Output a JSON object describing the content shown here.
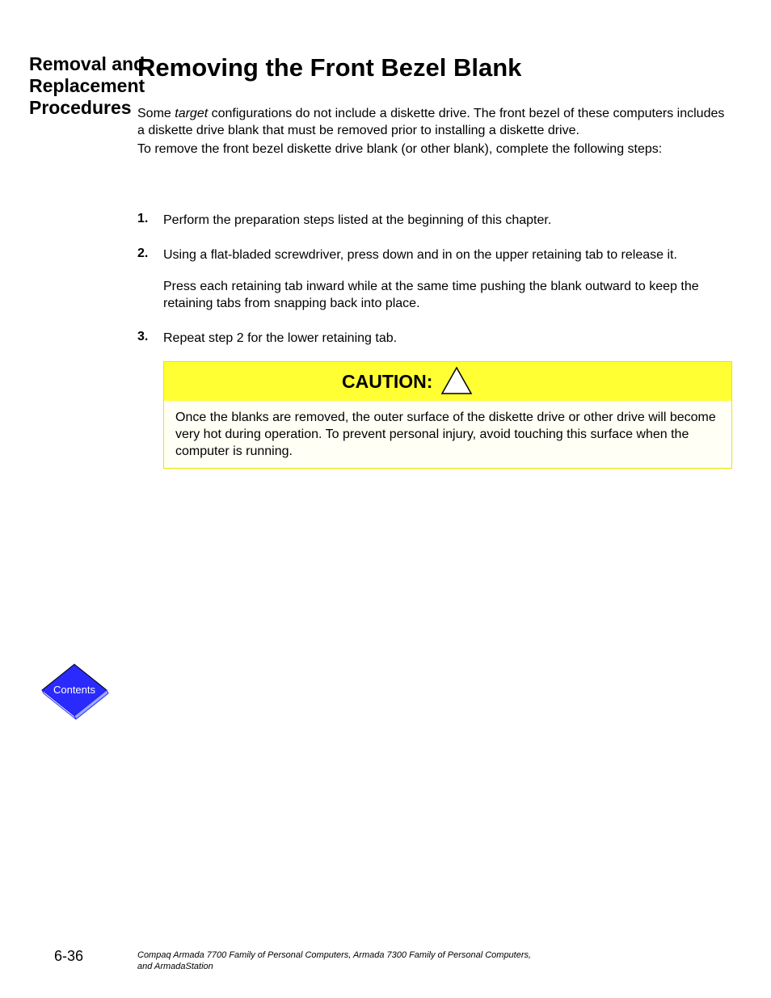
{
  "sidebar": {
    "title": "Removal and\nReplacement\nProcedures",
    "contents_label": "Contents",
    "page_number": "6-36"
  },
  "content": {
    "heading": "Removing the Front Bezel Blank",
    "intro_line1_pre": "Some ",
    "intro_line1_tgt": "target",
    "intro_line1_post": " configurations do not include a diskette drive. The front bezel of these computers includes a diskette drive blank that must be removed prior to installing a diskette drive.",
    "intro_line2": "To remove the front bezel diskette drive blank (or other blank), complete the following steps:",
    "steps": [
      {
        "num": "1.",
        "body": [
          "Perform the preparation steps listed at the beginning of this chapter."
        ]
      },
      {
        "num": "2.",
        "body": [
          "Using a flat-bladed screwdriver, press down and in on the upper retaining tab to release it.",
          "Press each retaining tab inward while at the same time pushing the blank outward to keep the retaining tabs from snapping back into place."
        ]
      },
      {
        "num": "3.",
        "body": [
          "Repeat step 2 for the lower retaining tab.",
          "__CAUTION__",
          "Once the blanks are removed, the outer surface of the diskette drive or other drive will become very hot during operation. To prevent personal injury, avoid touching this surface when the computer is running."
        ]
      }
    ],
    "caution_label": "CAUTION:",
    "caution_text": "Once the blanks are removed, the outer surface of the diskette drive or other drive will become very hot during operation. To prevent personal injury, avoid touching this surface when the computer is running."
  },
  "footer": {
    "line1": "Compaq Armada 7700 Family of Personal Computers, Armada 7300 Family of Personal Computers,",
    "line2": "and ArmadaStation"
  }
}
